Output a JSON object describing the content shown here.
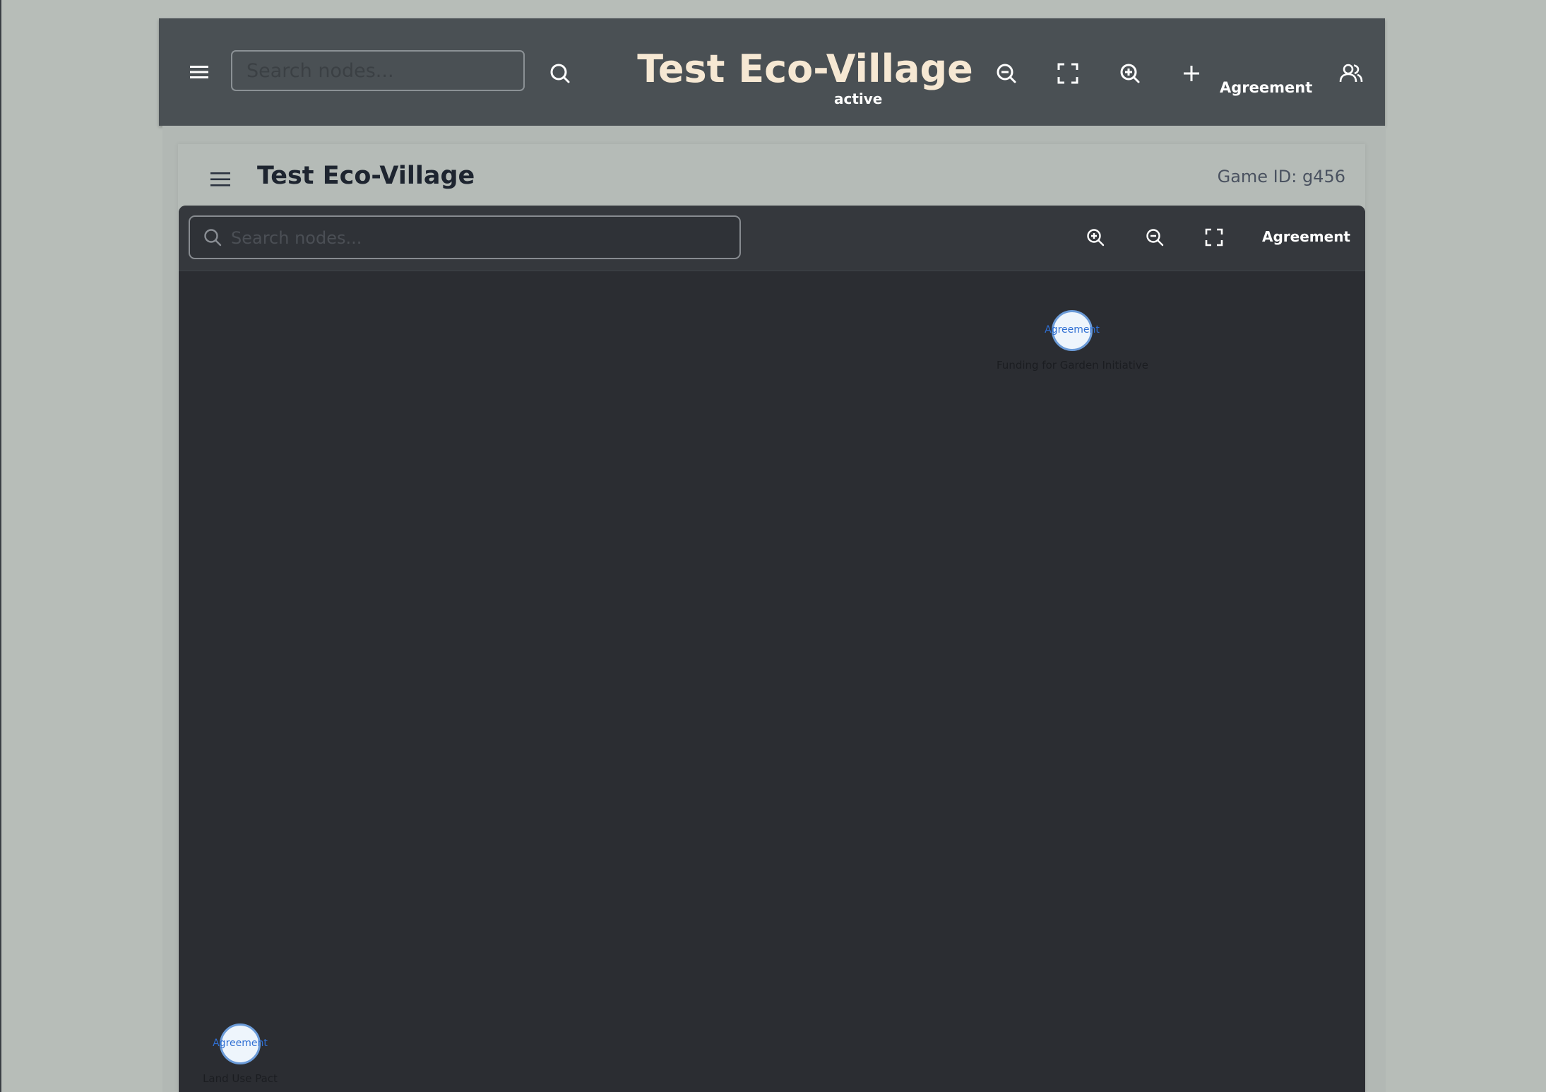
{
  "topbar": {
    "menu_icon": "hamburger-menu-icon",
    "search_placeholder": "Search nodes...",
    "search_icon": "search-icon",
    "title": "Test Eco-Village",
    "status": "active",
    "zoom_out_icon": "zoom-out-icon",
    "fit_icon": "fullscreen-icon",
    "zoom_in_icon": "zoom-in-icon",
    "add_icon": "plus-icon",
    "add_label": "Agreement",
    "users_icon": "users-icon"
  },
  "game_header": {
    "menu_icon": "hamburger-menu-icon",
    "title": "Test Eco-Village",
    "game_id": "Game ID: g456"
  },
  "canvas_toolbar": {
    "search_placeholder": "Search nodes...",
    "zoom_in_icon": "zoom-in-icon",
    "zoom_out_icon": "zoom-out-icon",
    "fit_icon": "fullscreen-icon",
    "type_label": "Agreement"
  },
  "nodes": [
    {
      "type": "Agreement",
      "label": "Funding for Garden Initiative"
    },
    {
      "type": "Agreement",
      "label": "Land Use Pact"
    }
  ],
  "colors": {
    "topbar_bg": "#4a5054",
    "page_bg": "#b7bdb8",
    "canvas_bg": "#2b2d32",
    "title_text": "#f6e8d3",
    "node_fill": "#eef5fc",
    "node_stroke": "#6b9bd8",
    "node_type_text": "#2f6fd3"
  }
}
